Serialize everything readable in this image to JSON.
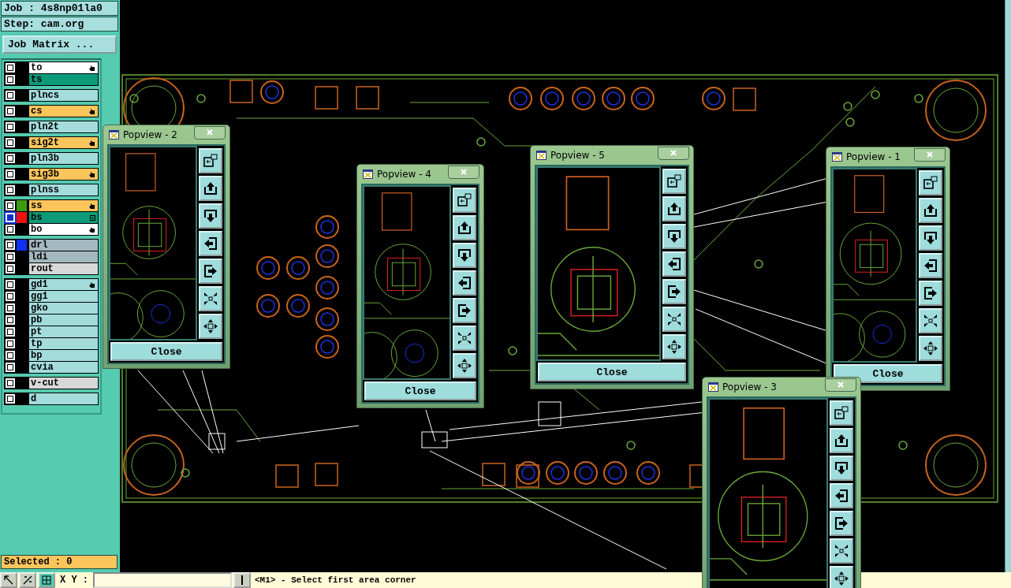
{
  "job": {
    "label": "Job : 4s8np01la0",
    "step": "Step: cam.org",
    "matrix_button": "Job Matrix ..."
  },
  "layer_groups": [
    {
      "layers": [
        {
          "name": "to",
          "kind": "silk",
          "selected": false,
          "affected": true,
          "work_layer": false
        },
        {
          "name": "ts",
          "kind": "mask",
          "selected": false,
          "affected": false,
          "work_layer": false
        }
      ]
    },
    {
      "layers": [
        {
          "name": "plncs",
          "kind": "plane",
          "selected": false,
          "affected": false,
          "work_layer": false
        }
      ]
    },
    {
      "layers": [
        {
          "name": "cs",
          "kind": "signal",
          "selected": false,
          "affected": true,
          "work_layer": false
        }
      ]
    },
    {
      "layers": [
        {
          "name": "pln2t",
          "kind": "plane",
          "selected": false,
          "affected": false,
          "work_layer": false
        }
      ]
    },
    {
      "layers": [
        {
          "name": "sig2t",
          "kind": "signal",
          "selected": false,
          "affected": true,
          "work_layer": false
        }
      ]
    },
    {
      "layers": [
        {
          "name": "pln3b",
          "kind": "plane",
          "selected": false,
          "affected": false,
          "work_layer": false
        }
      ]
    },
    {
      "layers": [
        {
          "name": "sig3b",
          "kind": "signal",
          "selected": false,
          "affected": true,
          "work_layer": false
        }
      ]
    },
    {
      "layers": [
        {
          "name": "plnss",
          "kind": "plane",
          "selected": false,
          "affected": false,
          "work_layer": false
        }
      ]
    },
    {
      "layers": [
        {
          "name": "ss",
          "kind": "signal",
          "color": "#3c9a10",
          "selected": false,
          "affected": true,
          "work_layer": false
        },
        {
          "name": "bs",
          "kind": "mask",
          "color": "#f01010",
          "selected": true,
          "affected": false,
          "work_layer": true
        },
        {
          "name": "bo",
          "kind": "silk",
          "selected": false,
          "affected": true,
          "work_layer": false
        }
      ]
    },
    {
      "layers": [
        {
          "name": "drl",
          "kind": "drill",
          "color": "#1030f0",
          "selected": false,
          "affected": false,
          "work_layer": false
        },
        {
          "name": "ldi",
          "kind": "drill",
          "selected": false,
          "affected": false,
          "work_layer": false
        },
        {
          "name": "rout",
          "kind": "rout",
          "selected": false,
          "affected": false,
          "work_layer": false
        }
      ]
    },
    {
      "layers": [
        {
          "name": "gd1",
          "kind": "plane",
          "selected": false,
          "affected": true,
          "work_layer": false
        },
        {
          "name": "gg1",
          "kind": "plane",
          "selected": false,
          "affected": false,
          "work_layer": false
        },
        {
          "name": "gko",
          "kind": "plane",
          "selected": false,
          "affected": false,
          "work_layer": false
        },
        {
          "name": "pb",
          "kind": "plane",
          "selected": false,
          "affected": false,
          "work_layer": false
        },
        {
          "name": "pt",
          "kind": "plane",
          "selected": false,
          "affected": false,
          "work_layer": false
        },
        {
          "name": "tp",
          "kind": "plane",
          "selected": false,
          "affected": false,
          "work_layer": false
        },
        {
          "name": "bp",
          "kind": "plane",
          "selected": false,
          "affected": false,
          "work_layer": false
        },
        {
          "name": "cvia",
          "kind": "plane",
          "selected": false,
          "affected": false,
          "work_layer": false
        }
      ]
    },
    {
      "layers": [
        {
          "name": "v-cut",
          "kind": "rout",
          "selected": false,
          "affected": false,
          "work_layer": false
        }
      ]
    },
    {
      "layers": [
        {
          "name": "d",
          "kind": "plane",
          "selected": false,
          "affected": false,
          "work_layer": false
        }
      ]
    }
  ],
  "selected_count": "Selected : 0",
  "popviews": [
    {
      "title": "Popview - 2",
      "close_button": "Close"
    },
    {
      "title": "Popview - 4",
      "close_button": "Close"
    },
    {
      "title": "Popview - 5",
      "close_button": "Close"
    },
    {
      "title": "Popview - 1",
      "close_button": "Close"
    },
    {
      "title": "Popview - 3"
    }
  ],
  "status_bar": {
    "xy_label": "X Y :",
    "prompt": "<M1> - Select first area corner"
  }
}
